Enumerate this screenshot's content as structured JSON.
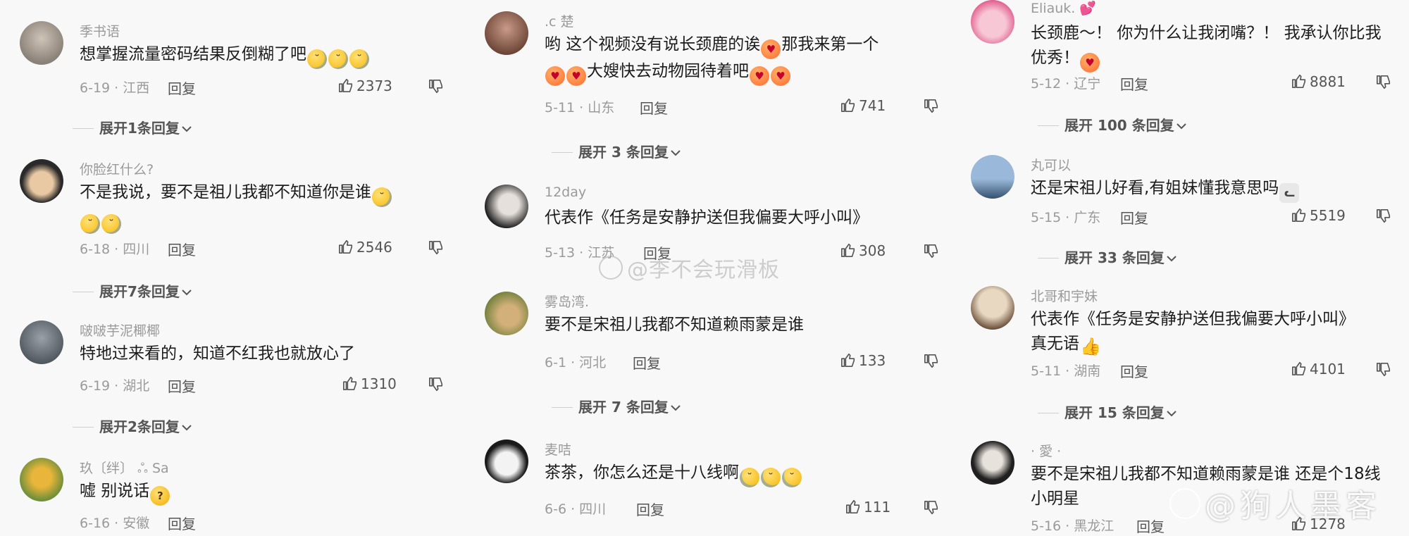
{
  "columns": [
    {
      "comments": [
        {
          "username": "季书语",
          "text": "想掌握流量密码结果反倒糊了吧",
          "emojis": [
            "tears",
            "tears",
            "tears"
          ],
          "date": "6-19",
          "location": "江西",
          "reply_label": "回复",
          "likes": "2373",
          "expand_label": "展开1条回复",
          "avatar_colors": [
            "#cfc4b8",
            "#8a8178"
          ]
        },
        {
          "username": "你脸红什么?",
          "text": "不是我说，要不是祖儿我都不知道你是谁",
          "emojis": [
            "tears",
            "tears",
            "tears"
          ],
          "date": "6-18",
          "location": "四川",
          "reply_label": "回复",
          "likes": "2546",
          "expand_label": "展开7条回复",
          "avatar_colors": [
            "#2a2a2a",
            "#e9c9a3"
          ]
        },
        {
          "username": "啵啵芋泥椰椰",
          "text": "特地过来看的，知道不红我也就放心了",
          "emojis": [],
          "date": "6-19",
          "location": "湖北",
          "reply_label": "回复",
          "likes": "1310",
          "expand_label": "展开2条回复",
          "avatar_colors": [
            "#9aa1a8",
            "#4f565e"
          ]
        },
        {
          "username": "玖〔绊〕 ஃ   Sa",
          "text": "嘘 别说话",
          "emojis": [
            "think"
          ],
          "date": "6-16",
          "location": "安徽",
          "reply_label": "回复",
          "likes": "",
          "expand_label": "",
          "avatar_colors": [
            "#e9b53a",
            "#6f8f3a"
          ]
        }
      ]
    },
    {
      "comments": [
        {
          "username": ".c 楚",
          "text_lines": [
            "哟 这个视频没有说长颈鹿的诶",
            "那我来第一个",
            "大嫂快去动物园待着吧"
          ],
          "date": "5-11",
          "location": "山东",
          "reply_label": "回复",
          "likes": "741",
          "expand_label": "展开 3 条回复",
          "avatar_colors": [
            "#c99a86",
            "#6b4436"
          ]
        },
        {
          "username": "12day",
          "text": "代表作《任务是安静护送但我偏要大呼小叫》",
          "emojis": [],
          "date": "5-13",
          "location": "江苏",
          "reply_label": "回复",
          "likes": "308",
          "expand_label": "",
          "avatar_colors": [
            "#e5e0db",
            "#222222"
          ]
        },
        {
          "username": "雾岛湾.",
          "text": "要不是宋祖儿我都不知道赖雨蒙是谁",
          "emojis": [],
          "date": "6-1",
          "location": "河北",
          "reply_label": "回复",
          "likes": "133",
          "expand_label": "展开 7 条回复",
          "avatar_colors": [
            "#6e7f3a",
            "#d3b07a"
          ]
        },
        {
          "username": "麦咭",
          "text": "茶茶，你怎么还是十八线啊",
          "emojis": [
            "cry",
            "cry",
            "cry"
          ],
          "date": "6-6",
          "location": "四川",
          "reply_label": "回复",
          "likes": "111",
          "expand_label": "",
          "avatar_colors": [
            "#f3f3f3",
            "#1a1a1a"
          ]
        }
      ]
    },
    {
      "comments": [
        {
          "username": "Eliauk.",
          "text": "长颈鹿～！ 你为什么让我闭嘴？！ 我承认你比我优秀！",
          "emojis": [
            "love"
          ],
          "date": "5-12",
          "location": "辽宁",
          "reply_label": "回复",
          "likes": "8881",
          "expand_label": "展开 100 条回复",
          "avatar_colors": [
            "#f7c7d6",
            "#e05a8a"
          ]
        },
        {
          "username": "丸可以",
          "text": "还是宋祖儿好看,有姐妹懂我意思吗",
          "emojis": [
            "cat"
          ],
          "date": "5-15",
          "location": "广东",
          "reply_label": "回复",
          "likes": "5519",
          "expand_label": "展开 33 条回复",
          "avatar_colors": [
            "#9ab9da",
            "#34506e"
          ]
        },
        {
          "username": "北哥和宇妹",
          "text": "代表作《任务是安静护送但我偏要大呼小叫》真无语",
          "emojis": [
            "thumb"
          ],
          "date": "5-11",
          "location": "湖南",
          "reply_label": "回复",
          "likes": "4101",
          "expand_label": "展开 15 条回复",
          "avatar_colors": [
            "#e8d8c2",
            "#5a3d28"
          ]
        },
        {
          "username": "· 愛 ·",
          "text": "要不是宋祖儿我都不知道赖雨蒙是谁 还是个18线小明星",
          "emojis": [],
          "date": "5-16",
          "location": "黑龙江",
          "reply_label": "回复",
          "likes": "1278",
          "expand_label": "",
          "avatar_colors": [
            "#e8e2dc",
            "#202020"
          ]
        }
      ]
    }
  ],
  "watermarks": {
    "center": "@李不会玩滑板",
    "corner": "@狗人墨客"
  },
  "colors": {
    "background": "#f9f8f8",
    "text": "#1c1c1c",
    "secondary": "#9a9a9a"
  }
}
